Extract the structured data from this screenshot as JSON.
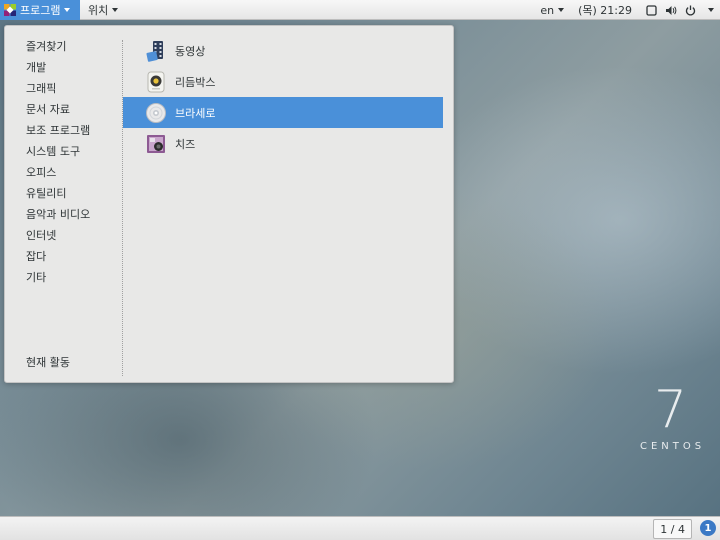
{
  "topbar": {
    "applications_label": "프로그램",
    "places_label": "위치",
    "language": "en",
    "clock": "(목) 21:29",
    "icons": [
      "centos-logo-icon",
      "window-icon",
      "volume-icon",
      "power-icon"
    ]
  },
  "menu": {
    "categories": [
      {
        "label": "즐겨찾기"
      },
      {
        "label": "개발"
      },
      {
        "label": "그래픽"
      },
      {
        "label": "문서 자료"
      },
      {
        "label": "보조 프로그램"
      },
      {
        "label": "시스템 도구"
      },
      {
        "label": "오피스"
      },
      {
        "label": "유틸리티"
      },
      {
        "label": "음악과 비디오"
      },
      {
        "label": "인터넷"
      },
      {
        "label": "잡다"
      },
      {
        "label": "기타"
      }
    ],
    "activities_label": "현재 활동",
    "apps": [
      {
        "label": "동영상",
        "icon": "video-player-icon"
      },
      {
        "label": "리듬박스",
        "icon": "rhythmbox-icon"
      },
      {
        "label": "브라세로",
        "icon": "brasero-disc-icon",
        "selected": true
      },
      {
        "label": "치즈",
        "icon": "cheese-camera-icon"
      }
    ],
    "selected_color": "#4a90d9"
  },
  "brand": {
    "number": "7",
    "word": "CENTOS"
  },
  "bottombar": {
    "workspace": "1 / 4",
    "notification": "1"
  }
}
